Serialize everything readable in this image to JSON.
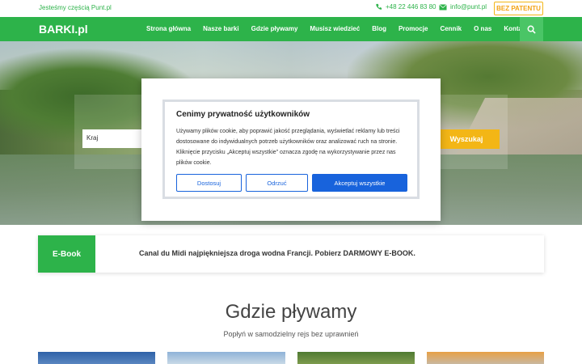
{
  "topbar": {
    "tagline": "Jesteśmy częścią Punt.pl",
    "phone": "+48 22 446 83 80",
    "email": "info@punt.pl",
    "patent_label": "BEZ PATENTU"
  },
  "nav": {
    "logo": "BARKI.pl",
    "items": [
      {
        "label": "Strona główna"
      },
      {
        "label": "Nasze barki"
      },
      {
        "label": "Gdzie pływamy"
      },
      {
        "label": "Musisz wiedzieć"
      },
      {
        "label": "Blog"
      },
      {
        "label": "Promocje"
      },
      {
        "label": "Cennik"
      },
      {
        "label": "O nas"
      },
      {
        "label": "Kontakt"
      }
    ],
    "search_icon": "search-icon"
  },
  "hero": {
    "kraj_placeholder": "Kraj",
    "search_button": "Wyszukaj"
  },
  "cookie": {
    "title": "Cenimy prywatność użytkowników",
    "text": "Używamy plików cookie, aby poprawić jakość przeglądania, wyświetlać reklamy lub treści dostosowane do indywidualnych potrzeb użytkowników oraz analizować ruch na stronie. Kliknięcie przycisku „Akceptuj wszystkie” oznacza zgodę na wykorzystywanie przez nas plików cookie.",
    "customize": "Dostosuj",
    "reject": "Odrzuć",
    "accept": "Akceptuj wszystkie"
  },
  "ebook": {
    "badge": "E-Book",
    "message": "Canal du Midi najpiękniejsza droga wodna Francji. Pobierz DARMOWY E-BOOK."
  },
  "section": {
    "title": "Gdzie pływamy",
    "subtitle": "Popłyń w samodzielny rejs bez uprawnień"
  },
  "colors": {
    "brand_green": "#2db34a",
    "accent_yellow": "#f3b616",
    "cookie_blue": "#1863dc"
  }
}
